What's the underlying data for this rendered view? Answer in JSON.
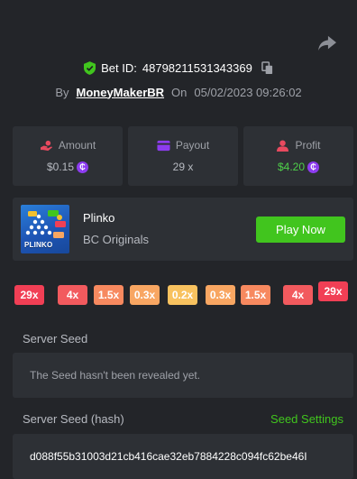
{
  "header": {
    "bet_id_label": "Bet ID:",
    "bet_id": "48798211531343369",
    "by_label": "By",
    "username": "MoneyMakerBR",
    "on_label": "On",
    "date": "05/02/2023 09:26:02"
  },
  "stats": {
    "amount": {
      "label": "Amount",
      "value": "$0.15",
      "icon": "money-hand-icon"
    },
    "payout": {
      "label": "Payout",
      "value": "29 x",
      "icon": "card-icon"
    },
    "profit": {
      "label": "Profit",
      "value": "$4.20",
      "icon": "profit-person-icon"
    }
  },
  "coin_symbol": "₵",
  "game": {
    "title": "Plinko",
    "subtitle": "BC Originals",
    "play_label": "Play Now",
    "thumb_word": "PLINKO"
  },
  "multipliers": [
    {
      "label": "29x",
      "color": "#f13f55"
    },
    {
      "label": "4x",
      "color": "#f25a5e"
    },
    {
      "label": "1.5x",
      "color": "#f7895f"
    },
    {
      "label": "0.3x",
      "color": "#f8a662"
    },
    {
      "label": "0.2x",
      "color": "#f8c25f"
    },
    {
      "label": "0.3x",
      "color": "#f8a662"
    },
    {
      "label": "1.5x",
      "color": "#f7895f"
    },
    {
      "label": "4x",
      "color": "#f25a5e"
    },
    {
      "label": "29x",
      "color": "#f13f55"
    }
  ],
  "server_seed": {
    "label": "Server Seed",
    "text": "The Seed hasn't been revealed yet."
  },
  "server_seed_hash": {
    "label": "Server Seed (hash)",
    "settings_label": "Seed Settings",
    "value": "d088f55b31003d21cb416cae32eb7884228c094fc62be46I"
  },
  "colors": {
    "background": "#232529",
    "panel": "#2d3035",
    "accent_green": "#41c51e",
    "coin_purple": "#8d3cf0"
  }
}
